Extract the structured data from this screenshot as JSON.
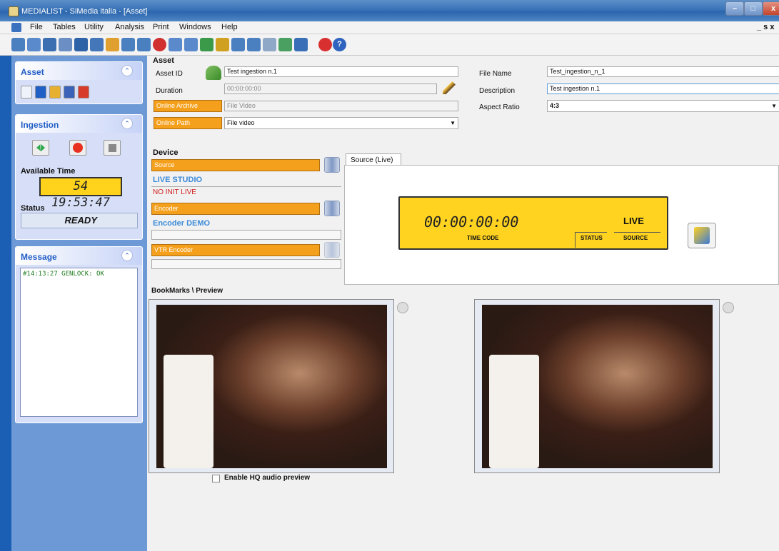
{
  "window": {
    "title": "MEDIALIST  - SiMedia italia - [Asset]"
  },
  "menu": [
    "File",
    "Tables",
    "Utility",
    "Analysis",
    "Print",
    "Windows",
    "Help"
  ],
  "mdi_controls": "_ ѕ x",
  "sidebar": {
    "asset": {
      "title": "Asset"
    },
    "ingestion": {
      "title": "Ingestion",
      "available_time_label": "Available Time",
      "available_time": "54 19:53:47",
      "status_label": "Status",
      "status": "READY"
    },
    "message": {
      "title": "Message",
      "lines": [
        "#14:13:27 GENLOCK: OK"
      ]
    }
  },
  "asset": {
    "section_title": "Asset",
    "asset_id_label": "Asset ID",
    "asset_id": "Test ingestion n.1",
    "duration_label": "Duration",
    "duration": "00:00:00:00",
    "online_archive_label": "Online Archive",
    "online_archive": "File Video",
    "online_path_label": "Online Path",
    "online_path": "File video",
    "file_name_label": "File Name",
    "file_name": "Test_ingestion_n_1",
    "description_label": "Description",
    "description": "Test ingestion n.1",
    "aspect_ratio_label": "Aspect Ratio",
    "aspect_ratio": "4:3"
  },
  "device": {
    "section_title": "Device",
    "source_label": "Source",
    "source_name": "LIVE STUDIO",
    "source_status": "NO INIT LIVE",
    "encoder_label": "Encoder",
    "encoder_name": "Encoder DEMO",
    "vtr_label": "VTR Encoder"
  },
  "source_live": {
    "tab": "Source (Live)",
    "timecode": "00:00:00:00",
    "live": "LIVE",
    "timecode_label": "TIME CODE",
    "status_label": "STATUS",
    "source_label": "SOURCE"
  },
  "bookmarks": {
    "section_title": "BookMarks \\ Preview",
    "hq_audio_label": "Enable HQ audio preview"
  },
  "colors": {
    "accent": "#f5a01c",
    "timecode_bg": "#ffd320",
    "sidebar_title": "#215dc6",
    "live_name": "#3c8ad8",
    "error": "#d02020"
  }
}
